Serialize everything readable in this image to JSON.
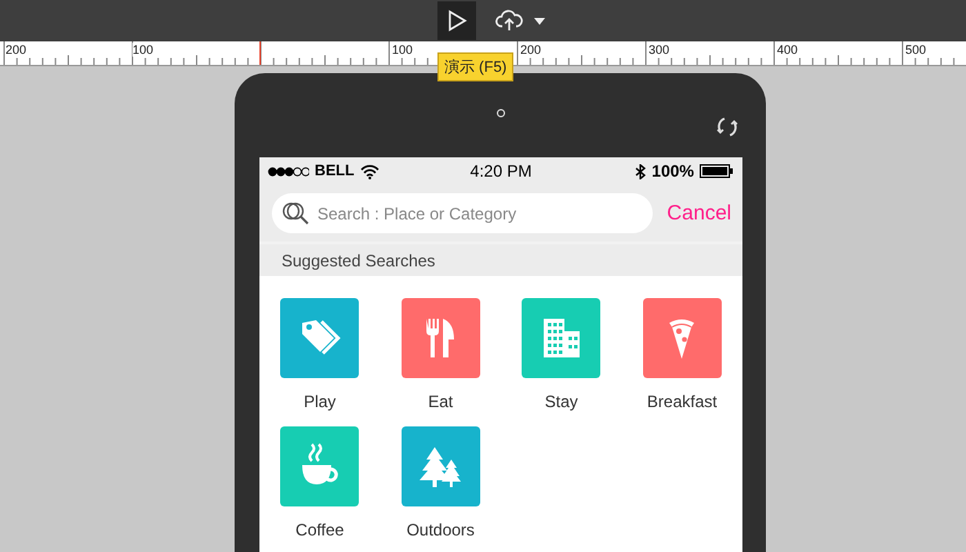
{
  "ruler": {
    "labels": [
      "200",
      "100",
      "100",
      "200",
      "300",
      "400",
      "500"
    ]
  },
  "tooltip": "演示 (F5)",
  "status_bar": {
    "carrier": "BELL",
    "time": "4:20 PM",
    "battery": "100%"
  },
  "search": {
    "placeholder": "Search : Place or Category",
    "cancel": "Cancel"
  },
  "section_title": "Suggested Searches",
  "categories": [
    {
      "label": "Play",
      "color": "#17b3cc"
    },
    {
      "label": "Eat",
      "color": "#ff6b6b"
    },
    {
      "label": "Stay",
      "color": "#17cdb2"
    },
    {
      "label": "Breakfast",
      "color": "#ff6b6b"
    },
    {
      "label": "Coffee",
      "color": "#17cdb2"
    },
    {
      "label": "Outdoors",
      "color": "#17b3cc"
    }
  ]
}
